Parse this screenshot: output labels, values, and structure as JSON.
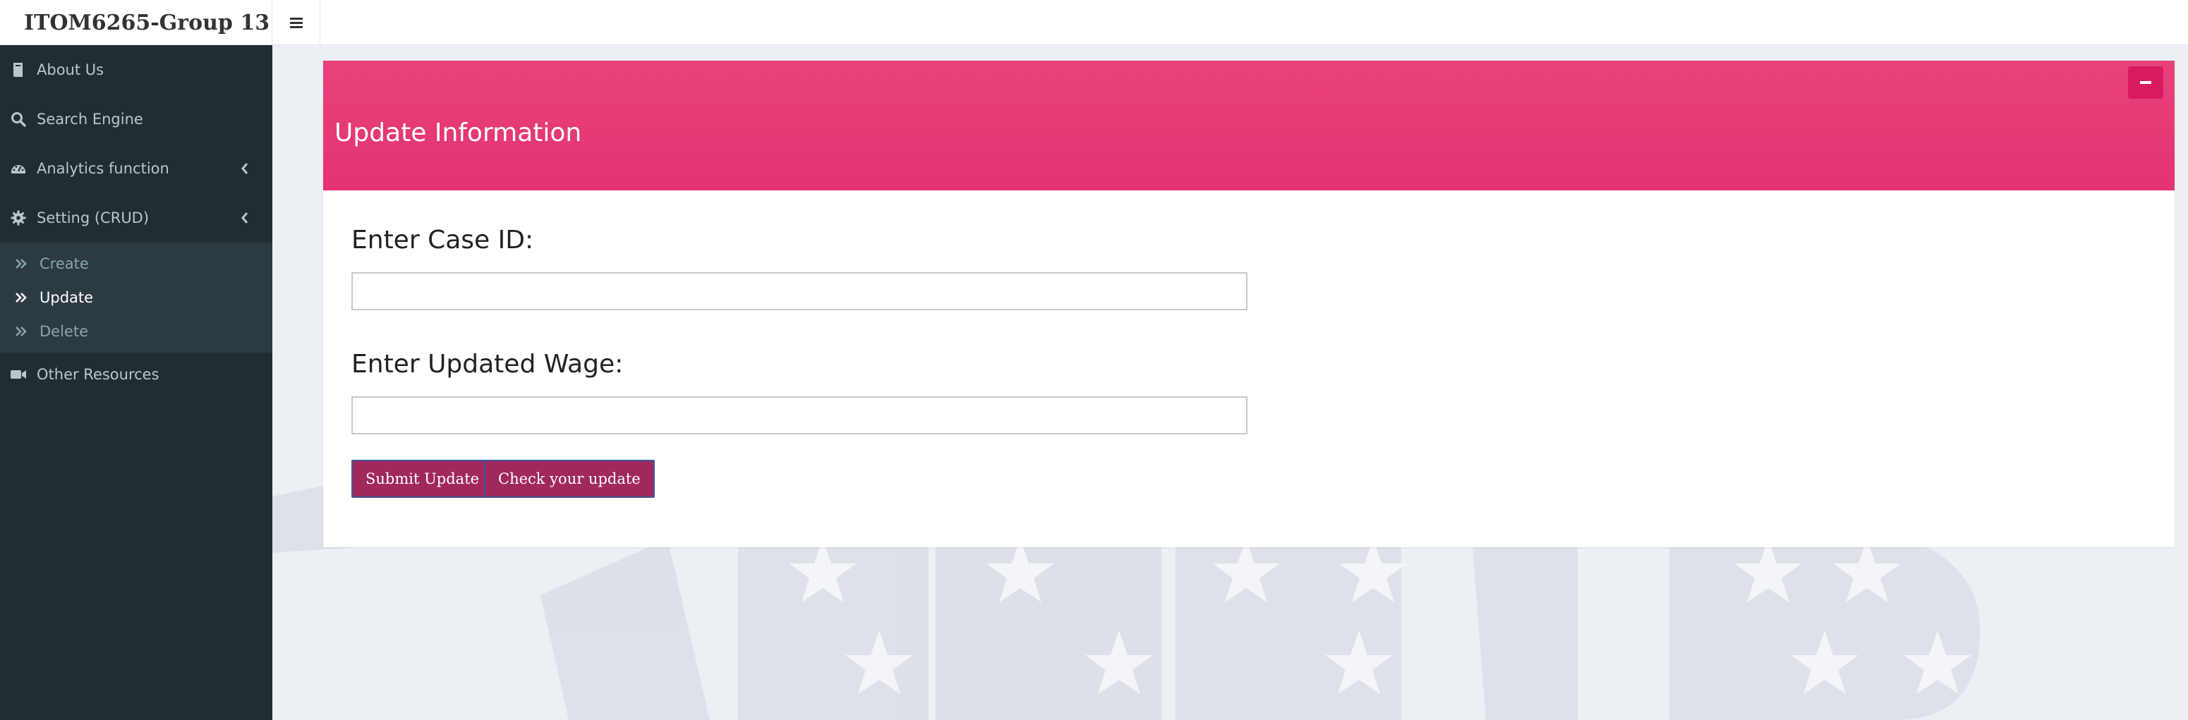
{
  "header": {
    "app_title": "ITOM6265-Group 13"
  },
  "sidebar": {
    "items": [
      {
        "label": "About Us",
        "icon": "book-icon"
      },
      {
        "label": "Search Engine",
        "icon": "search-icon"
      },
      {
        "label": "Analytics function",
        "icon": "dashboard-icon"
      },
      {
        "label": "Setting (CRUD)",
        "icon": "gear-icon"
      },
      {
        "label": "Other Resources",
        "icon": "video-camera-icon"
      }
    ],
    "submenu": [
      {
        "label": "Create",
        "icon": "double-chevron-right-icon"
      },
      {
        "label": "Update",
        "icon": "double-chevron-right-icon",
        "active": true
      },
      {
        "label": "Delete",
        "icon": "double-chevron-right-icon"
      }
    ]
  },
  "box": {
    "title": "Update Information",
    "case_id_label": "Enter Case ID:",
    "case_id_value": "",
    "wage_label": "Enter Updated Wage:",
    "wage_value": "",
    "submit_label": "Submit Update",
    "check_label": "Check your update"
  },
  "colors": {
    "sidebar_bg": "#222d32",
    "submenu_bg": "#2c3b41",
    "box_header": "#e33373",
    "collapse_button": "#d81b60",
    "button": "#a0285b"
  }
}
